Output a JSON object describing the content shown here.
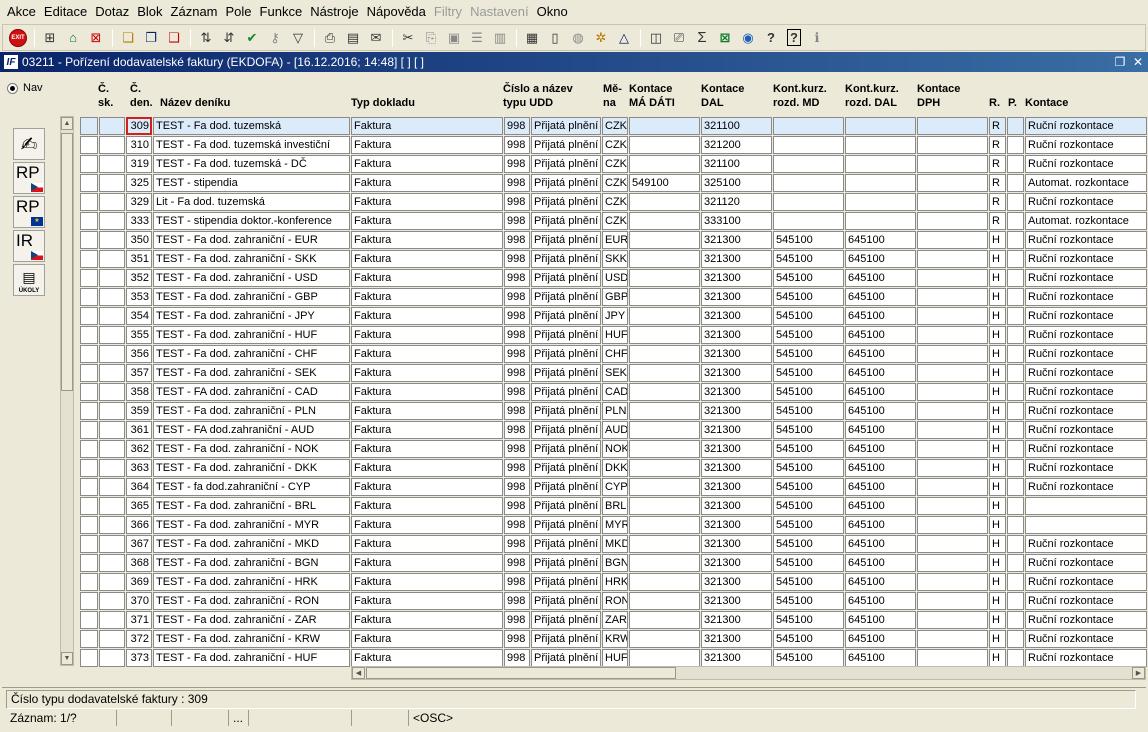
{
  "menu": [
    "Akce",
    "Editace",
    "Dotaz",
    "Blok",
    "Záznam",
    "Pole",
    "Funkce",
    "Nástroje",
    "Nápověda",
    "Filtry",
    "Nastavení",
    "Okno"
  ],
  "menu_disabled": [
    "Filtry",
    "Nastavení"
  ],
  "toolbar": {
    "exit_label": "EXIT",
    "icons": [
      "exit-icon",
      "insert-record-icon",
      "save-icon",
      "delete-record-icon",
      "enter-query-icon",
      "execute-query-icon",
      "cancel-query-icon",
      "sort-asc-icon",
      "sort-desc-icon",
      "accept-icon",
      "key-icon",
      "filter-icon",
      "print-icon",
      "print-preview-icon",
      "mail-icon",
      "cut-icon",
      "copy-icon",
      "paste-icon",
      "list-icon",
      "columns-icon",
      "form-icon",
      "document-icon",
      "globe-icon",
      "tools-icon",
      "triangle-icon",
      "chart-icon",
      "translate-icon",
      "sum-icon",
      "excel-icon",
      "outlook-icon",
      "help-icon",
      "whats-this-icon",
      "info-icon"
    ]
  },
  "window": {
    "title": "03211 - Pořízení dodavatelské faktury (EKDOFA) - [16.12.2016; 14:48]  [ ]  [ ]",
    "app_icon": "IF"
  },
  "nav_label": "Nav",
  "side_tools": [
    {
      "name": "edit-tool",
      "label": ""
    },
    {
      "name": "rp-cz-tool",
      "label": "RP"
    },
    {
      "name": "rp-eu-tool",
      "label": "RP"
    },
    {
      "name": "ir-cz-tool",
      "label": "IR"
    },
    {
      "name": "ukoly-tool",
      "label": "ÚKOLY"
    }
  ],
  "columns": {
    "c_sk": [
      "Č.",
      "sk."
    ],
    "c_den": [
      "Č.",
      "den."
    ],
    "nazev": "Název deníku",
    "typ": "Typ dokladu",
    "cislo": [
      "Číslo a název",
      "typu",
      "UDD"
    ],
    "mena": [
      "Mě-",
      "na"
    ],
    "kont_md": [
      "Kontace",
      "MÁ DÁTI"
    ],
    "kont_dal": [
      "Kontace",
      "DAL"
    ],
    "kurz_md": [
      "Kont.kurz.",
      "rozd. MD"
    ],
    "kurz_dal": [
      "Kont.kurz.",
      "rozd. DAL"
    ],
    "kont_dph": [
      "Kontace",
      "DPH"
    ],
    "r": "R.",
    "p": "P.",
    "kontace": "Kontace"
  },
  "rows": [
    {
      "den": "309",
      "nazev": "TEST - Fa dod. tuzemská",
      "typ": "Faktura",
      "cislo": "998",
      "udd": "Přijatá plnění z",
      "mena": "CZK",
      "md": "",
      "dal": "321100",
      "kmd": "",
      "kdal": "",
      "dph": "",
      "r": "R",
      "p": "",
      "kontace": "Ruční rozkontace"
    },
    {
      "den": "310",
      "nazev": "TEST - Fa dod. tuzemská investiční",
      "typ": "Faktura",
      "cislo": "998",
      "udd": "Přijatá plnění z",
      "mena": "CZK",
      "md": "",
      "dal": "321200",
      "kmd": "",
      "kdal": "",
      "dph": "",
      "r": "R",
      "p": "",
      "kontace": "Ruční rozkontace"
    },
    {
      "den": "319",
      "nazev": "TEST - Fa dod. tuzemská - DČ",
      "typ": "Faktura",
      "cislo": "998",
      "udd": "Přijatá plnění z",
      "mena": "CZK",
      "md": "",
      "dal": "321100",
      "kmd": "",
      "kdal": "",
      "dph": "",
      "r": "R",
      "p": "",
      "kontace": "Ruční rozkontace"
    },
    {
      "den": "325",
      "nazev": "TEST - stipendia",
      "typ": "Faktura",
      "cislo": "998",
      "udd": "Přijatá plnění z",
      "mena": "CZK",
      "md": "549100",
      "dal": "325100",
      "kmd": "",
      "kdal": "",
      "dph": "",
      "r": "R",
      "p": "",
      "kontace": "Automat. rozkontace"
    },
    {
      "den": "329",
      "nazev": "Lit - Fa dod. tuzemská",
      "typ": "Faktura",
      "cislo": "998",
      "udd": "Přijatá plnění z",
      "mena": "CZK",
      "md": "",
      "dal": "321120",
      "kmd": "",
      "kdal": "",
      "dph": "",
      "r": "R",
      "p": "",
      "kontace": "Ruční rozkontace"
    },
    {
      "den": "333",
      "nazev": "TEST - stipendia doktor.-konference",
      "typ": "Faktura",
      "cislo": "998",
      "udd": "Přijatá plnění z",
      "mena": "CZK",
      "md": "",
      "dal": "333100",
      "kmd": "",
      "kdal": "",
      "dph": "",
      "r": "R",
      "p": "",
      "kontace": "Automat. rozkontace"
    },
    {
      "den": "350",
      "nazev": "TEST - Fa dod. zahraniční - EUR",
      "typ": "Faktura",
      "cislo": "998",
      "udd": "Přijatá plnění z",
      "mena": "EUR",
      "md": "",
      "dal": "321300",
      "kmd": "545100",
      "kdal": "645100",
      "dph": "",
      "r": "H",
      "p": "",
      "kontace": "Ruční rozkontace"
    },
    {
      "den": "351",
      "nazev": "TEST - Fa dod. zahraniční - SKK",
      "typ": "Faktura",
      "cislo": "998",
      "udd": "Přijatá plnění z",
      "mena": "SKK",
      "md": "",
      "dal": "321300",
      "kmd": "545100",
      "kdal": "645100",
      "dph": "",
      "r": "H",
      "p": "",
      "kontace": "Ruční rozkontace"
    },
    {
      "den": "352",
      "nazev": "TEST - Fa dod. zahraniční - USD",
      "typ": "Faktura",
      "cislo": "998",
      "udd": "Přijatá plnění z",
      "mena": "USD",
      "md": "",
      "dal": "321300",
      "kmd": "545100",
      "kdal": "645100",
      "dph": "",
      "r": "H",
      "p": "",
      "kontace": "Ruční rozkontace"
    },
    {
      "den": "353",
      "nazev": "TEST - Fa dod. zahraniční - GBP",
      "typ": "Faktura",
      "cislo": "998",
      "udd": "Přijatá plnění z",
      "mena": "GBP",
      "md": "",
      "dal": "321300",
      "kmd": "545100",
      "kdal": "645100",
      "dph": "",
      "r": "H",
      "p": "",
      "kontace": "Ruční rozkontace"
    },
    {
      "den": "354",
      "nazev": "TEST - Fa dod. zahraniční - JPY",
      "typ": "Faktura",
      "cislo": "998",
      "udd": "Přijatá plnění z",
      "mena": "JPY",
      "md": "",
      "dal": "321300",
      "kmd": "545100",
      "kdal": "645100",
      "dph": "",
      "r": "H",
      "p": "",
      "kontace": "Ruční rozkontace"
    },
    {
      "den": "355",
      "nazev": "TEST - Fa dod. zahraniční - HUF",
      "typ": "Faktura",
      "cislo": "998",
      "udd": "Přijatá plnění z",
      "mena": "HUF",
      "md": "",
      "dal": "321300",
      "kmd": "545100",
      "kdal": "645100",
      "dph": "",
      "r": "H",
      "p": "",
      "kontace": "Ruční rozkontace"
    },
    {
      "den": "356",
      "nazev": "TEST - Fa dod. zahraniční - CHF",
      "typ": "Faktura",
      "cislo": "998",
      "udd": "Přijatá plnění z",
      "mena": "CHF",
      "md": "",
      "dal": "321300",
      "kmd": "545100",
      "kdal": "645100",
      "dph": "",
      "r": "H",
      "p": "",
      "kontace": "Ruční rozkontace"
    },
    {
      "den": "357",
      "nazev": "TEST - Fa dod. zahraniční - SEK",
      "typ": "Faktura",
      "cislo": "998",
      "udd": "Přijatá plnění z",
      "mena": "SEK",
      "md": "",
      "dal": "321300",
      "kmd": "545100",
      "kdal": "645100",
      "dph": "",
      "r": "H",
      "p": "",
      "kontace": "Ruční rozkontace"
    },
    {
      "den": "358",
      "nazev": "TEST - FA dod. zahraniční - CAD",
      "typ": "Faktura",
      "cislo": "998",
      "udd": "Přijatá plnění z",
      "mena": "CAD",
      "md": "",
      "dal": "321300",
      "kmd": "545100",
      "kdal": "645100",
      "dph": "",
      "r": "H",
      "p": "",
      "kontace": "Ruční rozkontace"
    },
    {
      "den": "359",
      "nazev": "TEST - Fa dod. zahraniční - PLN",
      "typ": "Faktura",
      "cislo": "998",
      "udd": "Přijatá plnění z",
      "mena": "PLN",
      "md": "",
      "dal": "321300",
      "kmd": "545100",
      "kdal": "645100",
      "dph": "",
      "r": "H",
      "p": "",
      "kontace": "Ruční rozkontace"
    },
    {
      "den": "361",
      "nazev": "TEST - FA dod.zahraniční - AUD",
      "typ": "Faktura",
      "cislo": "998",
      "udd": "Přijatá plnění z",
      "mena": "AUD",
      "md": "",
      "dal": "321300",
      "kmd": "545100",
      "kdal": "645100",
      "dph": "",
      "r": "H",
      "p": "",
      "kontace": "Ruční rozkontace"
    },
    {
      "den": "362",
      "nazev": "TEST - Fa dod. zahraniční - NOK",
      "typ": "Faktura",
      "cislo": "998",
      "udd": "Přijatá plnění z",
      "mena": "NOK",
      "md": "",
      "dal": "321300",
      "kmd": "545100",
      "kdal": "645100",
      "dph": "",
      "r": "H",
      "p": "",
      "kontace": "Ruční rozkontace"
    },
    {
      "den": "363",
      "nazev": "TEST - Fa dod. zahraniční - DKK",
      "typ": "Faktura",
      "cislo": "998",
      "udd": "Přijatá plnění z",
      "mena": "DKK",
      "md": "",
      "dal": "321300",
      "kmd": "545100",
      "kdal": "645100",
      "dph": "",
      "r": "H",
      "p": "",
      "kontace": "Ruční rozkontace"
    },
    {
      "den": "364",
      "nazev": "TEST - fa dod.zahraniční - CYP",
      "typ": "Faktura",
      "cislo": "998",
      "udd": "Přijatá plnění z",
      "mena": "CYP",
      "md": "",
      "dal": "321300",
      "kmd": "545100",
      "kdal": "645100",
      "dph": "",
      "r": "H",
      "p": "",
      "kontace": "Ruční rozkontace"
    },
    {
      "den": "365",
      "nazev": "TEST - Fa dod. zahraniční - BRL",
      "typ": "Faktura",
      "cislo": "998",
      "udd": "Přijatá plnění z",
      "mena": "BRL",
      "md": "",
      "dal": "321300",
      "kmd": "545100",
      "kdal": "645100",
      "dph": "",
      "r": "H",
      "p": "",
      "kontace": ""
    },
    {
      "den": "366",
      "nazev": "TEST - Fa dod. zahraniční - MYR",
      "typ": "Faktura",
      "cislo": "998",
      "udd": "Přijatá plnění z",
      "mena": "MYR",
      "md": "",
      "dal": "321300",
      "kmd": "545100",
      "kdal": "645100",
      "dph": "",
      "r": "H",
      "p": "",
      "kontace": ""
    },
    {
      "den": "367",
      "nazev": "TEST - Fa dod. zahraniční - MKD",
      "typ": "Faktura",
      "cislo": "998",
      "udd": "Přijatá plnění z",
      "mena": "MKD",
      "md": "",
      "dal": "321300",
      "kmd": "545100",
      "kdal": "645100",
      "dph": "",
      "r": "H",
      "p": "",
      "kontace": "Ruční rozkontace"
    },
    {
      "den": "368",
      "nazev": "TEST - Fa dod. zahraniční - BGN",
      "typ": "Faktura",
      "cislo": "998",
      "udd": "Přijatá plnění z",
      "mena": "BGN",
      "md": "",
      "dal": "321300",
      "kmd": "545100",
      "kdal": "645100",
      "dph": "",
      "r": "H",
      "p": "",
      "kontace": "Ruční rozkontace"
    },
    {
      "den": "369",
      "nazev": "TEST - Fa dod. zahraniční - HRK",
      "typ": "Faktura",
      "cislo": "998",
      "udd": "Přijatá plnění z",
      "mena": "HRK",
      "md": "",
      "dal": "321300",
      "kmd": "545100",
      "kdal": "645100",
      "dph": "",
      "r": "H",
      "p": "",
      "kontace": "Ruční rozkontace"
    },
    {
      "den": "370",
      "nazev": "TEST - Fa dod. zahraniční - RON",
      "typ": "Faktura",
      "cislo": "998",
      "udd": "Přijatá plnění z",
      "mena": "RON",
      "md": "",
      "dal": "321300",
      "kmd": "545100",
      "kdal": "645100",
      "dph": "",
      "r": "H",
      "p": "",
      "kontace": "Ruční rozkontace"
    },
    {
      "den": "371",
      "nazev": "TEST - Fa dod. zahraniční - ZAR",
      "typ": "Faktura",
      "cislo": "998",
      "udd": "Přijatá plnění z",
      "mena": "ZAR",
      "md": "",
      "dal": "321300",
      "kmd": "545100",
      "kdal": "645100",
      "dph": "",
      "r": "H",
      "p": "",
      "kontace": "Ruční rozkontace"
    },
    {
      "den": "372",
      "nazev": "TEST - Fa dod. zahraniční - KRW",
      "typ": "Faktura",
      "cislo": "998",
      "udd": "Přijatá plnění z",
      "mena": "KRW",
      "md": "",
      "dal": "321300",
      "kmd": "545100",
      "kdal": "645100",
      "dph": "",
      "r": "H",
      "p": "",
      "kontace": "Ruční rozkontace"
    },
    {
      "den": "373",
      "nazev": "TEST - Fa dod. zahraniční - HUF",
      "typ": "Faktura",
      "cislo": "998",
      "udd": "Přijatá plnění z",
      "mena": "HUF",
      "md": "",
      "dal": "321300",
      "kmd": "545100",
      "kdal": "645100",
      "dph": "",
      "r": "H",
      "p": "",
      "kontace": "Ruční rozkontace"
    }
  ],
  "status": {
    "message": "Číslo typu dodavatelské faktury : 309",
    "record": "Záznam: 1/?",
    "seg_dots": "...",
    "mode": "<OSC>"
  },
  "colors": {
    "title_bar": "#0a246a",
    "selected_row": "#dcebf9",
    "focus_border": "#d02020",
    "background": "#ece9d8"
  }
}
